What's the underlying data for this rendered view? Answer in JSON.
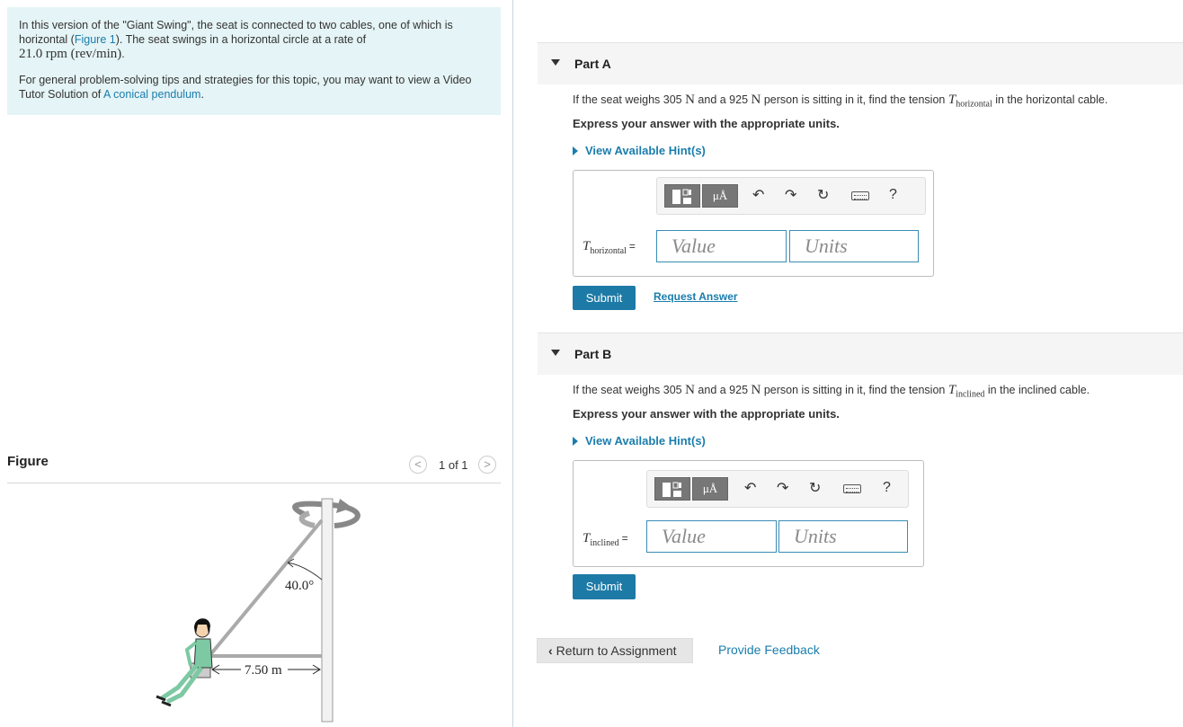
{
  "problem": {
    "intro_part1": "In this version of the \"Giant Swing\", the seat is connected to two cables, one of which is horizontal (",
    "figure_link": "Figure 1",
    "intro_part2": "). The seat swings in a horizontal circle at a rate of",
    "rate_value": "21.0",
    "rate_units": "rpm (rev/min)",
    "period": ".",
    "tips_text": "For general problem-solving tips and strategies for this topic, you may want to view a Video Tutor Solution of ",
    "tips_link": "A conical pendulum",
    "tips_end": "."
  },
  "figure": {
    "title": "Figure",
    "pager_prev": "<",
    "pager_next": ">",
    "pager_count": "1 of 1",
    "angle_label": "40.0°",
    "distance_label": "7.50 m"
  },
  "part_a": {
    "label": "Part A",
    "question_pre": "If the seat weighs 305",
    "unit_N": "N",
    "question_mid": "and a 925",
    "question_mid2": "person is sitting in it, find the tension",
    "tension_symbol": "T",
    "tension_sub": "horizontal",
    "question_post": "in the horizontal cable.",
    "instruction": "Express your answer with the appropriate units.",
    "hint_label": "View Available Hint(s)",
    "var_symbol": "T",
    "var_sub": "horizontal",
    "equals": "=",
    "value_placeholder": "Value",
    "units_placeholder": "Units",
    "submit_label": "Submit",
    "request_answer_label": "Request Answer"
  },
  "part_b": {
    "label": "Part B",
    "question_pre": "If the seat weighs 305",
    "unit_N": "N",
    "question_mid": "and a 925",
    "question_mid2": "person is sitting in it, find the tension",
    "tension_symbol": "T",
    "tension_sub": "inclined",
    "question_post": "in the inclined cable.",
    "instruction": "Express your answer with the appropriate units.",
    "hint_label": "View Available Hint(s)",
    "var_symbol": "T",
    "var_sub": "inclined",
    "equals": "=",
    "value_placeholder": "Value",
    "units_placeholder": "Units",
    "submit_label": "Submit"
  },
  "toolbar": {
    "units_button": "μÅ",
    "undo_icon": "undo-icon",
    "redo_icon": "redo-icon",
    "reset_icon": "reset-icon",
    "keyboard_icon": "keyboard-icon",
    "help_label": "?"
  },
  "footer": {
    "return_label": "Return to Assignment",
    "feedback_label": "Provide Feedback"
  },
  "colors": {
    "accent": "#1d7aa6",
    "link": "#1a7dad",
    "intro_bg": "#e5f4f6"
  }
}
